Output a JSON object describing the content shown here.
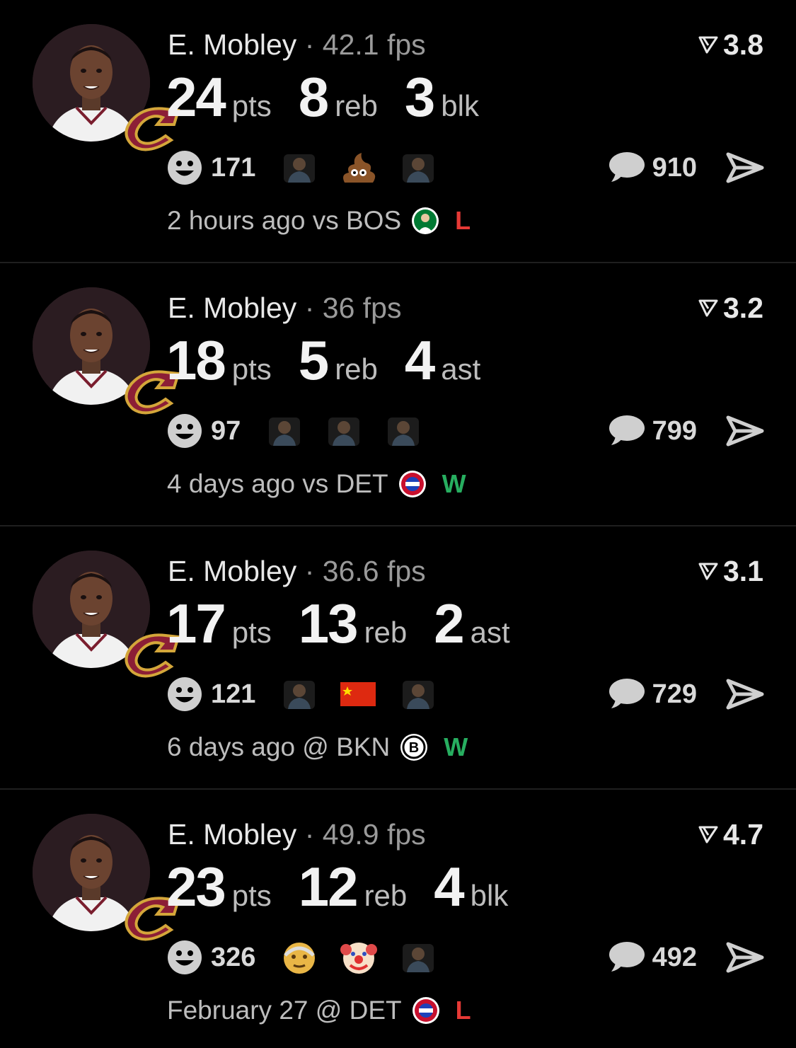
{
  "colors": {
    "win": "#27ae60",
    "loss": "#e53935",
    "background": "#000000"
  },
  "posts": [
    {
      "player": "E. Mobley",
      "separator": "·",
      "fps": "42.1 fps",
      "rating": "3.8",
      "stats": [
        {
          "value": "24",
          "unit": "pts"
        },
        {
          "value": "8",
          "unit": "reb"
        },
        {
          "value": "3",
          "unit": "blk"
        }
      ],
      "reactions_count": "171",
      "reaction_thumbs": [
        "photo-thumb",
        "poop-emoji",
        "photo-thumb"
      ],
      "comments_count": "910",
      "time_opponent": "2 hours ago vs BOS",
      "opponent_logo": "celtics-logo",
      "result": "L"
    },
    {
      "player": "E. Mobley",
      "separator": "·",
      "fps": "36 fps",
      "rating": "3.2",
      "stats": [
        {
          "value": "18",
          "unit": "pts"
        },
        {
          "value": "5",
          "unit": "reb"
        },
        {
          "value": "4",
          "unit": "ast"
        }
      ],
      "reactions_count": "97",
      "reaction_thumbs": [
        "photo-thumb",
        "photo-thumb",
        "photo-thumb"
      ],
      "comments_count": "799",
      "time_opponent": "4 days ago vs DET",
      "opponent_logo": "pistons-logo",
      "result": "W"
    },
    {
      "player": "E. Mobley",
      "separator": "·",
      "fps": "36.6 fps",
      "rating": "3.1",
      "stats": [
        {
          "value": "17",
          "unit": "pts"
        },
        {
          "value": "13",
          "unit": "reb"
        },
        {
          "value": "2",
          "unit": "ast"
        }
      ],
      "reactions_count": "121",
      "reaction_thumbs": [
        "photo-thumb",
        "china-flag",
        "photo-thumb"
      ],
      "comments_count": "729",
      "time_opponent": "6 days ago @ BKN",
      "opponent_logo": "nets-logo",
      "result": "W"
    },
    {
      "player": "E. Mobley",
      "separator": "·",
      "fps": "49.9 fps",
      "rating": "4.7",
      "stats": [
        {
          "value": "23",
          "unit": "pts"
        },
        {
          "value": "12",
          "unit": "reb"
        },
        {
          "value": "4",
          "unit": "blk"
        }
      ],
      "reactions_count": "326",
      "reaction_thumbs": [
        "old-man-emoji",
        "clown-emoji",
        "photo-thumb"
      ],
      "comments_count": "492",
      "time_opponent": "February 27 @ DET",
      "opponent_logo": "pistons-logo",
      "result": "L"
    }
  ]
}
